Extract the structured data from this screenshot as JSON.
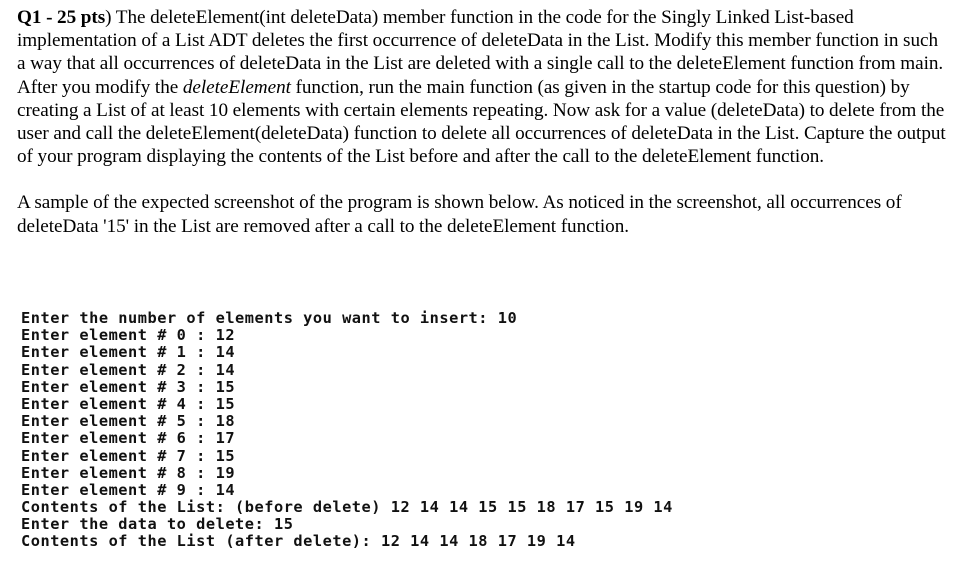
{
  "document": {
    "question_label": "Q1 - 25 pts",
    "paragraphs": [
      {
        "id": "p1",
        "runs": [
          {
            "text": "Q1 - 25 pts",
            "style": "bold"
          },
          {
            "text": ") The deleteElement(int deleteData) member function in the code for the Singly Linked List-based implementation of a List ADT deletes the first occurrence of deleteData in the List. Modify this member function in such a way that all occurrences of deleteData in the List are deleted with a single call to the deleteElement function from main. After you modify the ",
            "style": "normal"
          },
          {
            "text": "deleteElement",
            "style": "italic"
          },
          {
            "text": " function, run the main function (as given in the startup code for this question) by creating a List of at least 10 elements with certain elements repeating. Now ask for a value (deleteData) to delete from the user and call the deleteElement(deleteData) function to delete all occurrences of deleteData in the List. Capture the output of your program displaying the contents of the List before and after the call to the deleteElement function.",
            "style": "normal"
          }
        ]
      },
      {
        "id": "p2",
        "runs": [
          {
            "text": "A sample of the expected screenshot of the program is shown below. As noticed in the screenshot, all occurrences of deleteData '15' in the List are removed after a call to the deleteElement function.",
            "style": "normal"
          }
        ]
      }
    ]
  },
  "console_output": {
    "prompt_count": "Enter the number of elements you want to insert: 10",
    "element_prompts": [
      "Enter element # 0 : 12",
      "Enter element # 1 : 14",
      "Enter element # 2 : 14",
      "Enter element # 3 : 15",
      "Enter element # 4 : 15",
      "Enter element # 5 : 18",
      "Enter element # 6 : 17",
      "Enter element # 7 : 15",
      "Enter element # 8 : 19",
      "Enter element # 9 : 14"
    ],
    "contents_before": "Contents of the List: (before delete) 12 14 14 15 15 18 17 15 19 14",
    "prompt_delete": "Enter the data to delete: 15",
    "contents_after": "Contents of the List (after delete): 12 14 14 18 17 19 14",
    "lines": [
      "Enter the number of elements you want to insert: 10",
      "Enter element # 0 : 12",
      "Enter element # 1 : 14",
      "Enter element # 2 : 14",
      "Enter element # 3 : 15",
      "Enter element # 4 : 15",
      "Enter element # 5 : 18",
      "Enter element # 6 : 17",
      "Enter element # 7 : 15",
      "Enter element # 8 : 19",
      "Enter element # 9 : 14",
      "Contents of the List: (before delete) 12 14 14 15 15 18 17 15 19 14",
      "Enter the data to delete: 15",
      "Contents of the List (after delete): 12 14 14 18 17 19 14"
    ],
    "list_before_values": [
      12,
      14,
      14,
      15,
      15,
      18,
      17,
      15,
      19,
      14
    ],
    "list_after_values": [
      12,
      14,
      14,
      18,
      17,
      19,
      14
    ],
    "delete_data_value": "15",
    "element_count": "10"
  },
  "colors": {
    "page_background": "#ffffff",
    "body_text": "#000000",
    "console_text": "#111111"
  }
}
